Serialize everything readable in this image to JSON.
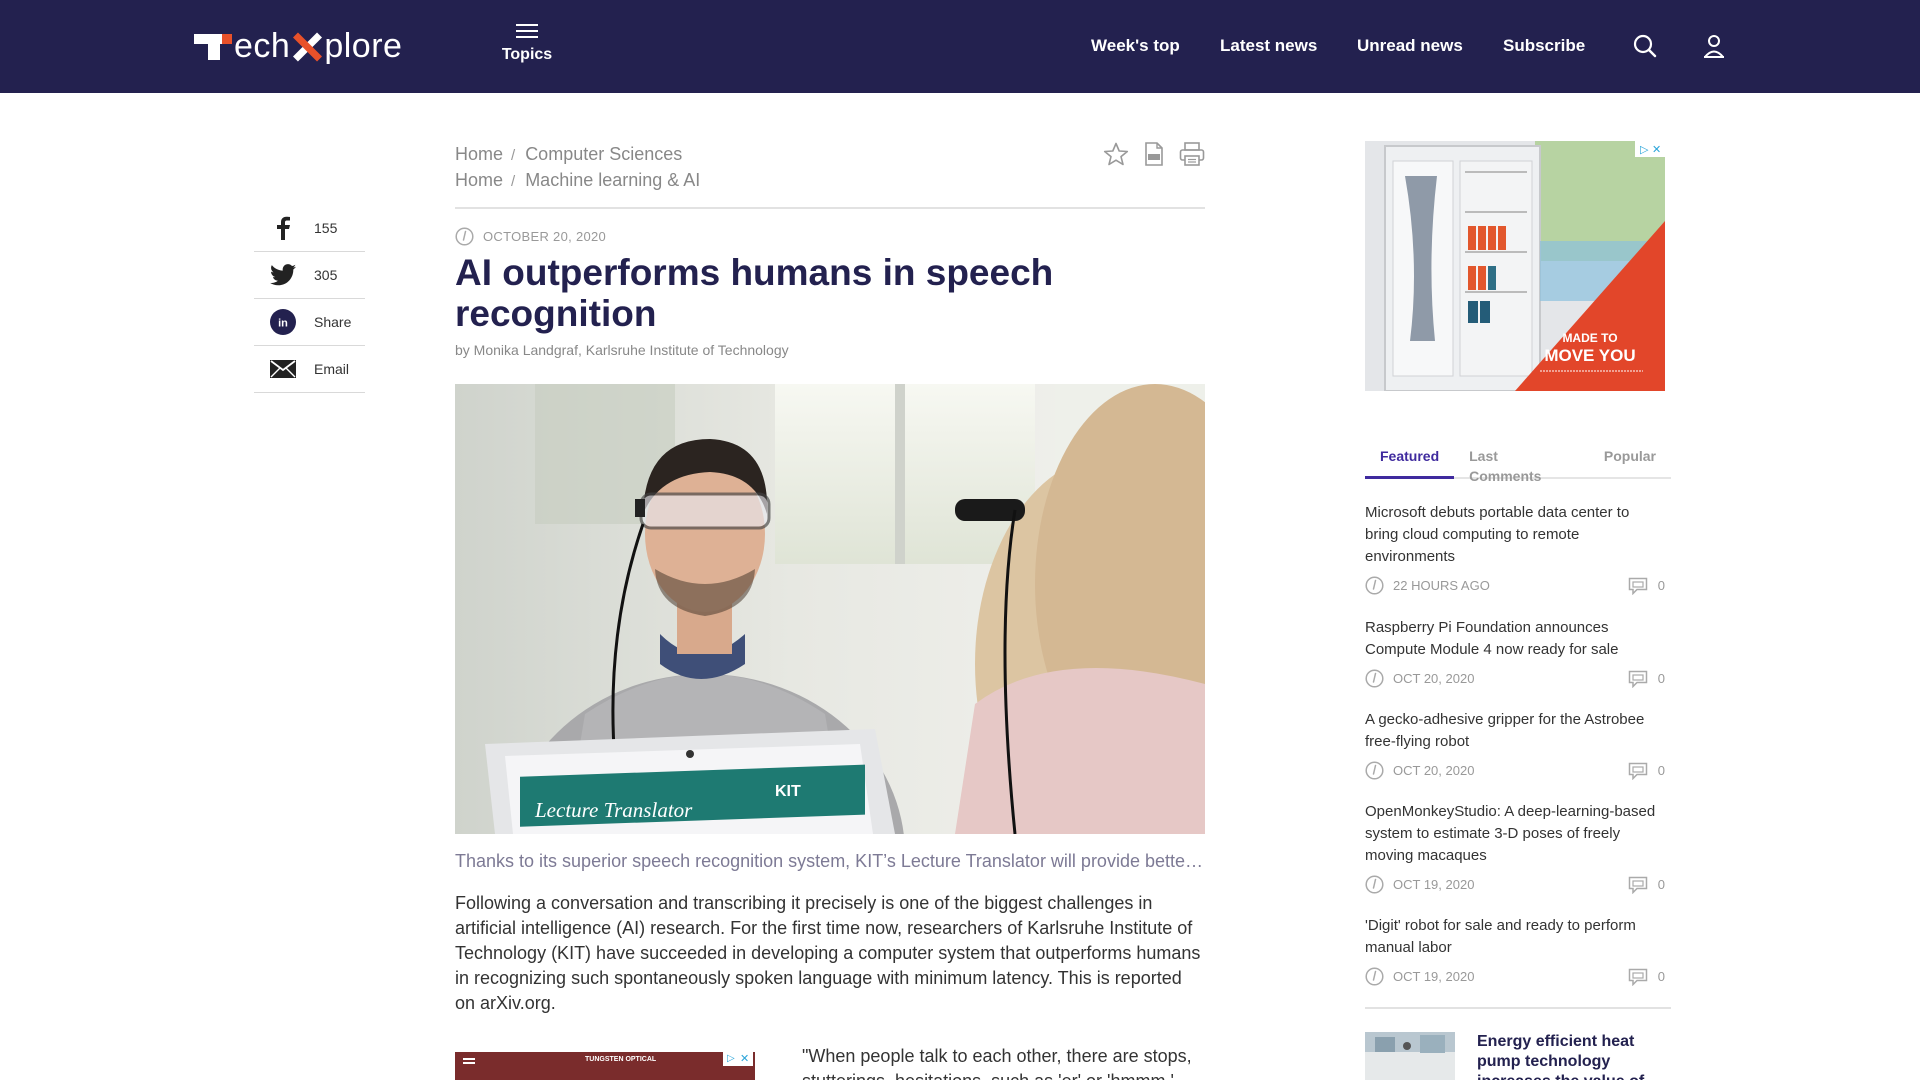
{
  "header": {
    "logo_text_1": "ech",
    "logo_text_2": "plore",
    "topics_label": "Topics",
    "nav": [
      "Week's top",
      "Latest news",
      "Unread news",
      "Subscribe"
    ]
  },
  "share": [
    {
      "icon": "facebook-icon",
      "label": "155"
    },
    {
      "icon": "twitter-icon",
      "label": "305"
    },
    {
      "icon": "linkedin-icon",
      "label": "Share"
    },
    {
      "icon": "email-icon",
      "label": "Email"
    }
  ],
  "breadcrumbs": [
    {
      "home": "Home",
      "section": "Computer Sciences"
    },
    {
      "home": "Home",
      "section": "Machine learning & AI"
    }
  ],
  "article": {
    "date": "OCTOBER 20, 2020",
    "title": "AI outperforms humans in speech recognition",
    "byline": "by Monika Landgraf, Karlsruhe Institute of Technology",
    "photo_screen_text": "Lecture Translator",
    "photo_kit_text": "KIT",
    "caption": "Thanks to its superior speech recognition system, KIT’s Lecture Translator will provide better services to students",
    "body": "Following a conversation and transcribing it precisely is one of the biggest challenges in artificial intelligence (AI) research. For the first time now, researchers of Karlsruhe Institute of Technology (KIT) have succeeded in developing a computer system that outperforms humans in recognizing such spontaneously spoken language with minimum latency. This is reported on arXiv.org.",
    "quote": "\"When people talk to each other, there are stops, stutterings, hesitations, such as 'er' or 'hmmm,'"
  },
  "ad_top": {
    "line1": "MADE TO",
    "line2": "MOVE YOU"
  },
  "ad_small": {
    "brand": "TUNGSTEN OPTICAL"
  },
  "tabs": [
    "Featured",
    "Last Comments",
    "Popular"
  ],
  "news": [
    {
      "title": "Microsoft debuts portable data center to bring cloud computing to remote environments",
      "time": "22 HOURS AGO",
      "comments": "0"
    },
    {
      "title": "Raspberry Pi Foundation announces Compute Module 4 now ready for sale",
      "time": "OCT 20, 2020",
      "comments": "0"
    },
    {
      "title": "A gecko-adhesive gripper for the Astrobee free-flying robot",
      "time": "OCT 20, 2020",
      "comments": "0"
    },
    {
      "title": "OpenMonkeyStudio: A deep-learning-based system to estimate 3-D poses of freely moving macaques",
      "time": "OCT 19, 2020",
      "comments": "0"
    },
    {
      "title": "'Digit' robot for sale and ready to perform manual labor",
      "time": "OCT 19, 2020",
      "comments": "0"
    }
  ],
  "featured_story": {
    "title": "Energy efficient heat pump technology increases the value of"
  },
  "colors": {
    "header_bg": "#23214f",
    "accent": "#e8512a",
    "tab_active": "#3f2a9e"
  }
}
